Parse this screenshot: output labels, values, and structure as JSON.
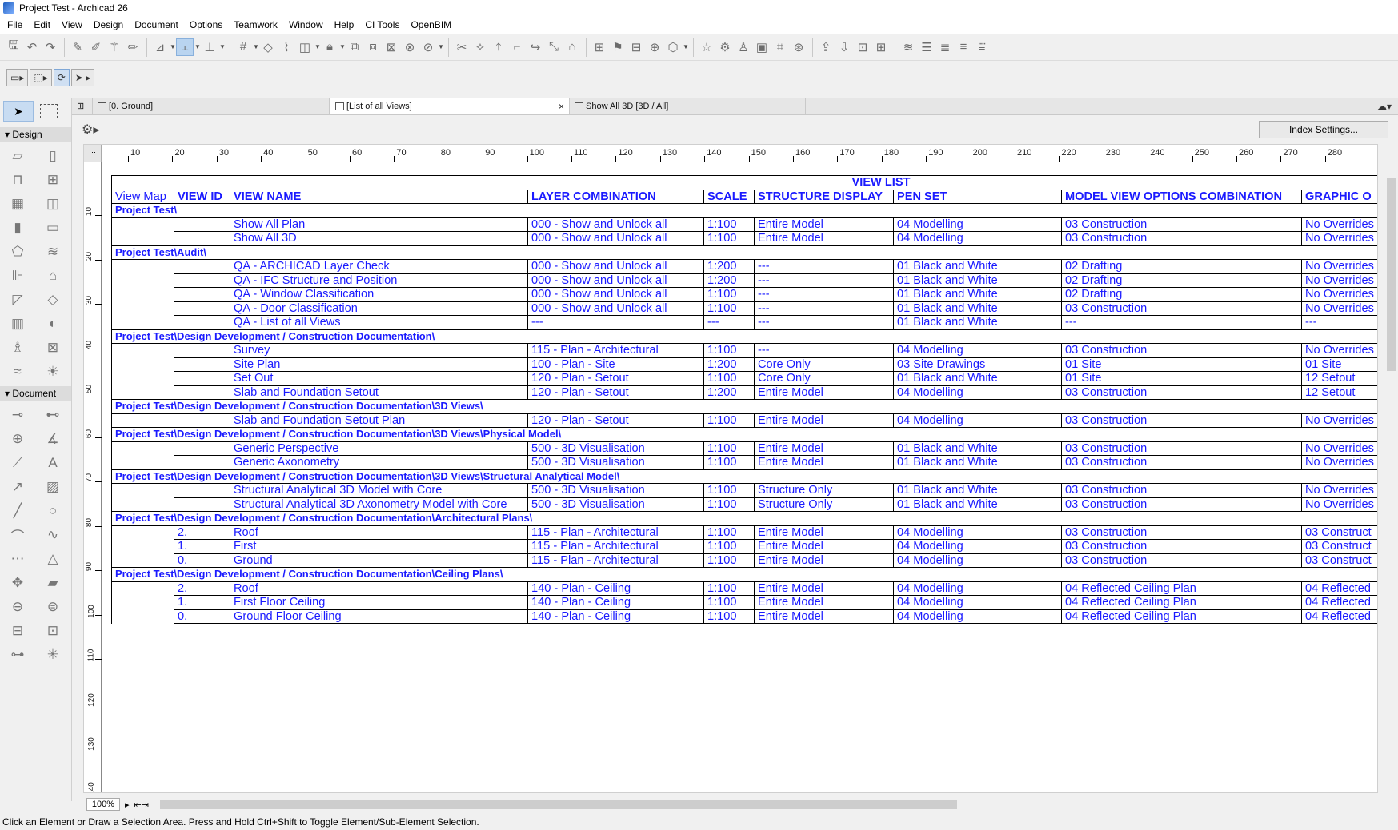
{
  "window": {
    "title": "Project Test - Archicad 26"
  },
  "menu": [
    "File",
    "Edit",
    "View",
    "Design",
    "Document",
    "Options",
    "Teamwork",
    "Window",
    "Help",
    "CI Tools",
    "OpenBIM"
  ],
  "toolbox": {
    "design_label": "Design",
    "document_label": "Document"
  },
  "tabs": [
    {
      "label": "[0. Ground]"
    },
    {
      "label": "[List of all Views]",
      "close": "×"
    },
    {
      "label": "Show All 3D [3D / All]"
    }
  ],
  "index_settings_label": "Index Settings...",
  "ruler": {
    "h": [
      "10",
      "20",
      "30",
      "40",
      "50",
      "60",
      "70",
      "80",
      "90",
      "100",
      "110",
      "120",
      "130",
      "140",
      "150",
      "160",
      "170",
      "180",
      "190",
      "200",
      "210",
      "220",
      "230",
      "240",
      "250",
      "260",
      "270",
      "280"
    ],
    "v": [
      "10",
      "20",
      "30",
      "40",
      "50",
      "60",
      "70",
      "80",
      "90",
      "100",
      "110",
      "120",
      "130",
      "140"
    ]
  },
  "zoom": "100%",
  "status": "Click an Element or Draw a Selection Area. Press and Hold Ctrl+Shift to Toggle Element/Sub-Element Selection.",
  "view_list": {
    "title": "VIEW LIST",
    "columns": [
      "View Map",
      "VIEW ID",
      "VIEW NAME",
      "LAYER COMBINATION",
      "SCALE",
      "STRUCTURE DISPLAY",
      "PEN SET",
      "MODEL VIEW OPTIONS COMBINATION",
      "GRAPHIC O"
    ],
    "groups": [
      {
        "name": "Project Test\\",
        "rows": [
          [
            "",
            "",
            "Show All Plan",
            "000 - Show and Unlock all",
            "1:100",
            "Entire Model",
            "04 Modelling",
            "03 Construction",
            "No Overrides"
          ],
          [
            "",
            "",
            "Show All 3D",
            "000 - Show and Unlock all",
            "1:100",
            "Entire Model",
            "04 Modelling",
            "03 Construction",
            "No Overrides"
          ]
        ]
      },
      {
        "name": "Project Test\\Audit\\",
        "rows": [
          [
            "",
            "",
            "QA - ARCHICAD Layer Check",
            "000 - Show and Unlock all",
            "1:200",
            "---",
            "01 Black and White",
            "02 Drafting",
            "No Overrides"
          ],
          [
            "",
            "",
            "QA - IFC Structure and Position",
            "000 - Show and Unlock all",
            "1:200",
            "---",
            "01 Black and White",
            "02 Drafting",
            "No Overrides"
          ],
          [
            "",
            "",
            "QA - Window Classification",
            "000 - Show and Unlock all",
            "1:100",
            "---",
            "01 Black and White",
            "02 Drafting",
            "No Overrides"
          ],
          [
            "",
            "",
            "QA - Door Classification",
            "000 - Show and Unlock all",
            "1:100",
            "---",
            "01 Black and White",
            "03 Construction",
            "No Overrides"
          ],
          [
            "",
            "",
            "QA - List of all Views",
            "---",
            "---",
            "---",
            "01 Black and White",
            "---",
            "---"
          ]
        ]
      },
      {
        "name": "Project Test\\Design Development / Construction Documentation\\",
        "rows": [
          [
            "",
            "",
            "Survey",
            "115 - Plan - Architectural",
            "1:100",
            "---",
            "04 Modelling",
            "03 Construction",
            "No Overrides"
          ],
          [
            "",
            "",
            "Site Plan",
            "100 - Plan - Site",
            "1:200",
            "Core Only",
            "03 Site Drawings",
            "01 Site",
            "01 Site"
          ],
          [
            "",
            "",
            "Set Out",
            "120 - Plan - Setout",
            "1:100",
            "Core Only",
            "01 Black and White",
            "01 Site",
            "12 Setout"
          ],
          [
            "",
            "",
            "Slab and Foundation Setout",
            "120 - Plan - Setout",
            "1:200",
            "Entire Model",
            "04 Modelling",
            "03 Construction",
            "12 Setout"
          ]
        ]
      },
      {
        "name": "Project Test\\Design Development / Construction Documentation\\3D Views\\",
        "rows": [
          [
            "",
            "",
            "Slab and Foundation Setout Plan",
            "120 - Plan - Setout",
            "1:100",
            "Entire Model",
            "04 Modelling",
            "03 Construction",
            "No Overrides"
          ]
        ]
      },
      {
        "name": "Project Test\\Design Development / Construction Documentation\\3D Views\\Physical Model\\",
        "rows": [
          [
            "",
            "",
            "Generic Perspective",
            "500 - 3D Visualisation",
            "1:100",
            "Entire Model",
            "01 Black and White",
            "03 Construction",
            "No Overrides"
          ],
          [
            "",
            "",
            "Generic Axonometry",
            "500 - 3D Visualisation",
            "1:100",
            "Entire Model",
            "01 Black and White",
            "03 Construction",
            "No Overrides"
          ]
        ]
      },
      {
        "name": "Project Test\\Design Development / Construction Documentation\\3D Views\\Structural Analytical Model\\",
        "rows": [
          [
            "",
            "",
            "Structural Analytical 3D Model with Core",
            "500 - 3D Visualisation",
            "1:100",
            "Structure Only",
            "01 Black and White",
            "03 Construction",
            "No Overrides"
          ],
          [
            "",
            "",
            "Structural Analytical 3D Axonometry Model with Core",
            "500 - 3D Visualisation",
            "1:100",
            "Structure Only",
            "01 Black and White",
            "03 Construction",
            "No Overrides"
          ]
        ]
      },
      {
        "name": "Project Test\\Design Development / Construction Documentation\\Architectural Plans\\",
        "rows": [
          [
            "",
            "2.",
            "Roof",
            "115 - Plan - Architectural",
            "1:100",
            "Entire Model",
            "04 Modelling",
            "03 Construction",
            "03 Construct"
          ],
          [
            "",
            "1.",
            "First",
            "115 - Plan - Architectural",
            "1:100",
            "Entire Model",
            "04 Modelling",
            "03 Construction",
            "03 Construct"
          ],
          [
            "",
            "0.",
            "Ground",
            "115 - Plan - Architectural",
            "1:100",
            "Entire Model",
            "04 Modelling",
            "03 Construction",
            "03 Construct"
          ]
        ]
      },
      {
        "name": "Project Test\\Design Development / Construction Documentation\\Ceiling Plans\\",
        "rows": [
          [
            "",
            "2.",
            "Roof",
            "140 - Plan - Ceiling",
            "1:100",
            "Entire Model",
            "04 Modelling",
            "04 Reflected Ceiling Plan",
            "04 Reflected"
          ],
          [
            "",
            "1.",
            "First Floor Ceiling",
            "140 - Plan - Ceiling",
            "1:100",
            "Entire Model",
            "04 Modelling",
            "04 Reflected Ceiling Plan",
            "04 Reflected"
          ],
          [
            "",
            "0.",
            "Ground Floor Ceiling",
            "140 - Plan - Ceiling",
            "1:100",
            "Entire Model",
            "04 Modelling",
            "04 Reflected Ceiling Plan",
            "04 Reflected"
          ]
        ]
      }
    ]
  }
}
